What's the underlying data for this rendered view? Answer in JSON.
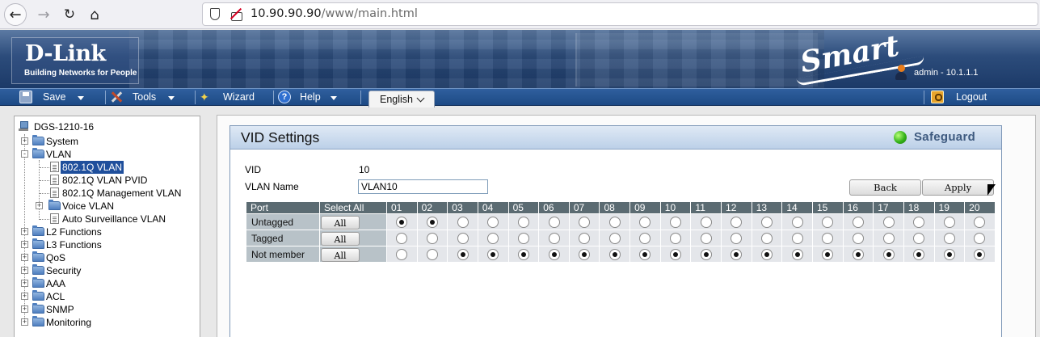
{
  "browser": {
    "url_host": "10.90.90.90",
    "url_path": "/www/main.html"
  },
  "header": {
    "logo_text": "D-Link",
    "logo_tagline": "Building Networks for People",
    "smart_logo": "Smart",
    "user_info": "admin - 10.1.1.1"
  },
  "menu": {
    "save": "Save",
    "tools": "Tools",
    "wizard": "Wizard",
    "help": "Help",
    "language": "English",
    "logout": "Logout"
  },
  "tree": {
    "root": "DGS-1210-16",
    "items": [
      {
        "label": "System",
        "type": "folder",
        "expander": "+"
      },
      {
        "label": "VLAN",
        "type": "folder",
        "expander": "-"
      },
      {
        "label": "802.1Q VLAN",
        "type": "page",
        "selected": true
      },
      {
        "label": "802.1Q VLAN PVID",
        "type": "page"
      },
      {
        "label": "802.1Q Management VLAN",
        "type": "page"
      },
      {
        "label": "Voice VLAN",
        "type": "folder",
        "expander": "+"
      },
      {
        "label": "Auto Surveillance VLAN",
        "type": "page"
      },
      {
        "label": "L2 Functions",
        "type": "folder",
        "expander": "+"
      },
      {
        "label": "L3 Functions",
        "type": "folder",
        "expander": "+"
      },
      {
        "label": "QoS",
        "type": "folder",
        "expander": "+"
      },
      {
        "label": "Security",
        "type": "folder",
        "expander": "+"
      },
      {
        "label": "AAA",
        "type": "folder",
        "expander": "+"
      },
      {
        "label": "ACL",
        "type": "folder",
        "expander": "+"
      },
      {
        "label": "SNMP",
        "type": "folder",
        "expander": "+"
      },
      {
        "label": "Monitoring",
        "type": "folder",
        "expander": "+"
      }
    ]
  },
  "vid_settings": {
    "title": "VID Settings",
    "safeguard": "Safeguard",
    "vid_label": "VID",
    "vid_value": "10",
    "vlan_name_label": "VLAN Name",
    "vlan_name_value": "VLAN10",
    "back_label": "Back",
    "apply_label": "Apply"
  },
  "port_table": {
    "port_header": "Port",
    "select_all_header": "Select All",
    "all_label": "All",
    "ports": [
      "01",
      "02",
      "03",
      "04",
      "05",
      "06",
      "07",
      "08",
      "09",
      "10",
      "11",
      "12",
      "13",
      "14",
      "15",
      "16",
      "17",
      "18",
      "19",
      "20"
    ],
    "rows": [
      {
        "label": "Untagged",
        "selected": [
          true,
          true,
          false,
          false,
          false,
          false,
          false,
          false,
          false,
          false,
          false,
          false,
          false,
          false,
          false,
          false,
          false,
          false,
          false,
          false
        ]
      },
      {
        "label": "Tagged",
        "selected": [
          false,
          false,
          false,
          false,
          false,
          false,
          false,
          false,
          false,
          false,
          false,
          false,
          false,
          false,
          false,
          false,
          false,
          false,
          false,
          false
        ]
      },
      {
        "label": "Not member",
        "selected": [
          false,
          false,
          true,
          true,
          true,
          true,
          true,
          true,
          true,
          true,
          true,
          true,
          true,
          true,
          true,
          true,
          true,
          true,
          true,
          true
        ]
      }
    ]
  },
  "colors": {
    "menu_bar": "#1d4a85",
    "table_header": "#5b6b72",
    "selected_tree_item": "#1f4f9c",
    "safeguard_led": "#34b219"
  }
}
